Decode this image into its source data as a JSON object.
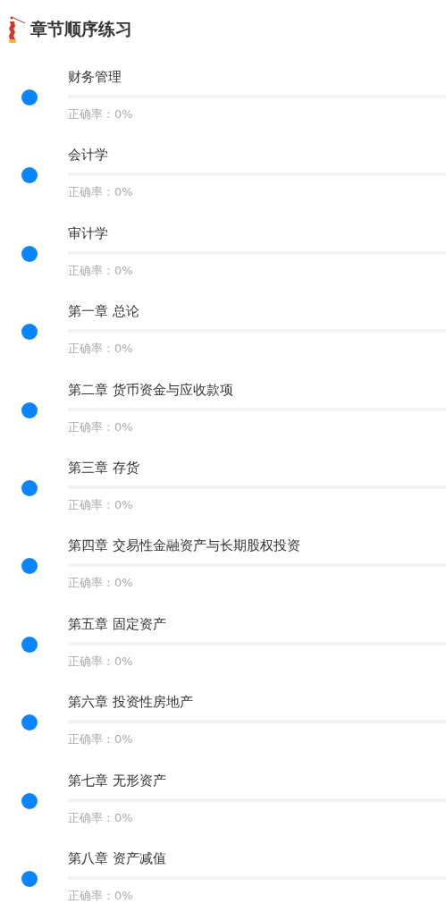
{
  "header": {
    "title": "章节顺序练习"
  },
  "chapters": [
    {
      "title": "财务管理",
      "level": 0,
      "accuracy": "正确率：0%"
    },
    {
      "title": "会计学",
      "level": 0,
      "accuracy": "正确率：0%"
    },
    {
      "title": "审计学",
      "level": 0,
      "accuracy": "正确率：0%"
    },
    {
      "title": "第一章 总论",
      "level": 0,
      "accuracy": "正确率：0%"
    },
    {
      "title": "第二章 货币资金与应收款项",
      "level": 0,
      "accuracy": "正确率：0%"
    },
    {
      "title": "第三章 存货",
      "level": 0,
      "accuracy": "正确率：0%"
    },
    {
      "title": "第四章 交易性金融资产与长期股权投资",
      "level": 0,
      "accuracy": "正确率：0%"
    },
    {
      "title": "第五章 固定资产",
      "level": 0,
      "accuracy": "正确率：0%"
    },
    {
      "title": "第六章 投资性房地产",
      "level": 0,
      "accuracy": "正确率：0%"
    },
    {
      "title": "第七章 无形资产",
      "level": 0,
      "accuracy": "正确率：0%"
    },
    {
      "title": "第八章 资产减值",
      "level": 0,
      "accuracy": "正确率：0%"
    }
  ]
}
